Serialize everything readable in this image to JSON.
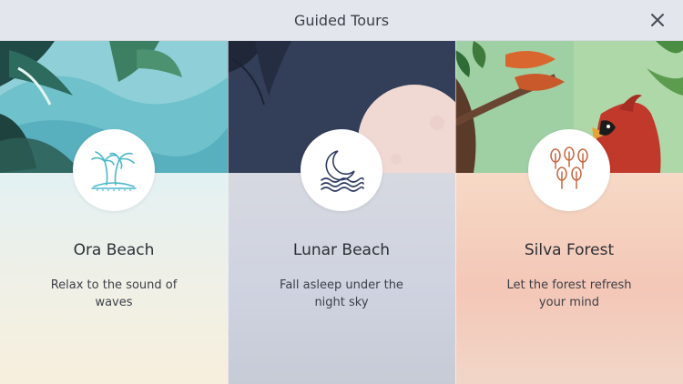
{
  "header": {
    "title": "Guided Tours",
    "close_icon": "close-icon"
  },
  "tours": [
    {
      "title": "Ora Beach",
      "description": "Relax to the sound of waves",
      "icon": "palm-island-icon",
      "accent": "#4ab8c9"
    },
    {
      "title": "Lunar Beach",
      "description": "Fall asleep under the night sky",
      "icon": "moon-waves-icon",
      "accent": "#2f3d63"
    },
    {
      "title": "Silva Forest",
      "description": "Let the forest refresh your mind",
      "icon": "trees-icon",
      "accent": "#c8673e"
    }
  ]
}
